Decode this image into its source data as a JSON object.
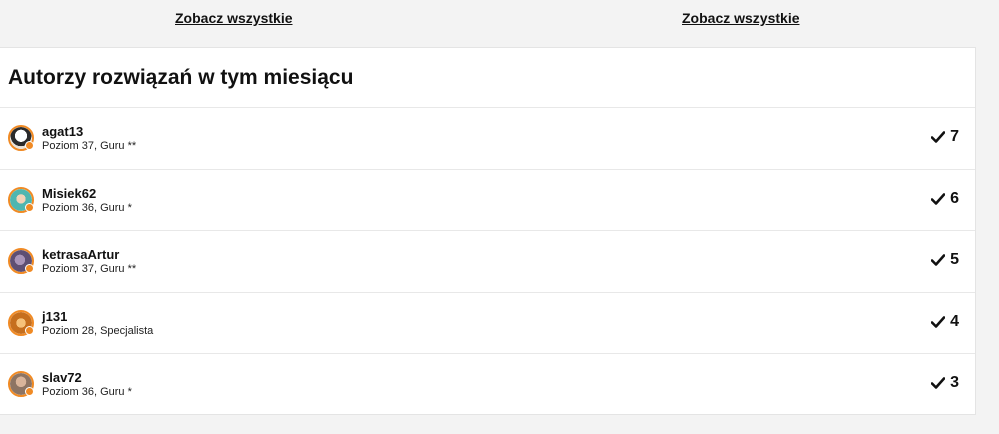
{
  "top_links": {
    "left_label": "Zobacz wszystkie",
    "right_label": "Zobacz wszystkie"
  },
  "panel": {
    "title": "Autorzy rozwiązań w tym miesiącu",
    "authors": [
      {
        "name": "agat13",
        "rank": "Poziom 37, Guru **",
        "score": "7",
        "avatar_color": "#e9e2d8",
        "icon": "avatar-icon"
      },
      {
        "name": "Misiek62",
        "rank": "Poziom 36, Guru *",
        "score": "6",
        "avatar_color": "#4fb6b0",
        "icon": "avatar-icon"
      },
      {
        "name": "ketrasaArtur",
        "rank": "Poziom 37, Guru **",
        "score": "5",
        "avatar_color": "#7b6c8e",
        "icon": "avatar-icon"
      },
      {
        "name": "j131",
        "rank": "Poziom 28, Specjalista",
        "score": "4",
        "avatar_color": "#d68a2c",
        "icon": "avatar-icon"
      },
      {
        "name": "slav72",
        "rank": "Poziom 36, Guru *",
        "score": "3",
        "avatar_color": "#b89a86",
        "icon": "avatar-icon"
      }
    ]
  },
  "colors": {
    "background": "#f3f3f3",
    "panel": "#ffffff",
    "accent_orange": "#f08a24",
    "text": "#111111"
  }
}
